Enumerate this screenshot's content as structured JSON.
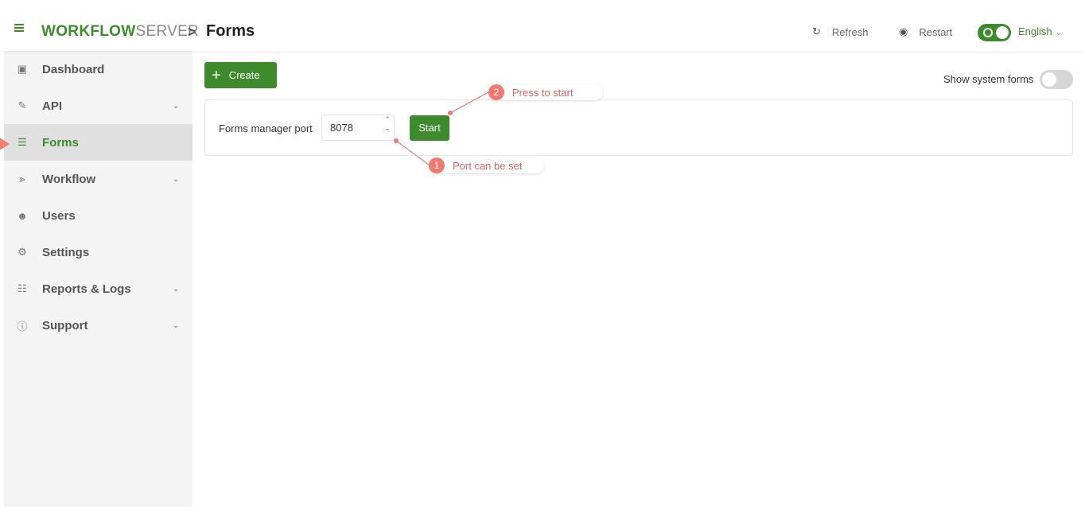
{
  "header": {
    "brand_bold": "WORKFLOW",
    "brand_light": "SERVER",
    "separator": ">",
    "title": "Forms",
    "refresh_label": "Refresh",
    "restart_label": "Restart",
    "language": "English"
  },
  "sidebar": {
    "items": [
      {
        "label": "Dashboard",
        "icon": "dashboard-icon"
      },
      {
        "label": "API",
        "icon": "plug-icon",
        "expandable": true
      },
      {
        "label": "Forms",
        "icon": "forms-icon",
        "active": true
      },
      {
        "label": "Workflow",
        "icon": "workflow-icon",
        "expandable": true
      },
      {
        "label": "Users",
        "icon": "users-icon"
      },
      {
        "label": "Settings",
        "icon": "settings-icon"
      },
      {
        "label": "Reports & Logs",
        "icon": "reports-icon",
        "expandable": true
      },
      {
        "label": "Support",
        "icon": "support-icon",
        "expandable": true
      }
    ]
  },
  "toolbar": {
    "create_label": "Create",
    "show_system_forms_label": "Show system forms"
  },
  "panel": {
    "port_label": "Forms manager port",
    "port_value": "8078",
    "start_label": "Start"
  },
  "callouts": [
    {
      "number": "1",
      "text": "Port can be set"
    },
    {
      "number": "2",
      "text": "Press to start"
    }
  ],
  "colors": {
    "accent": "#3d8b2c",
    "callout": "#f07a72"
  }
}
